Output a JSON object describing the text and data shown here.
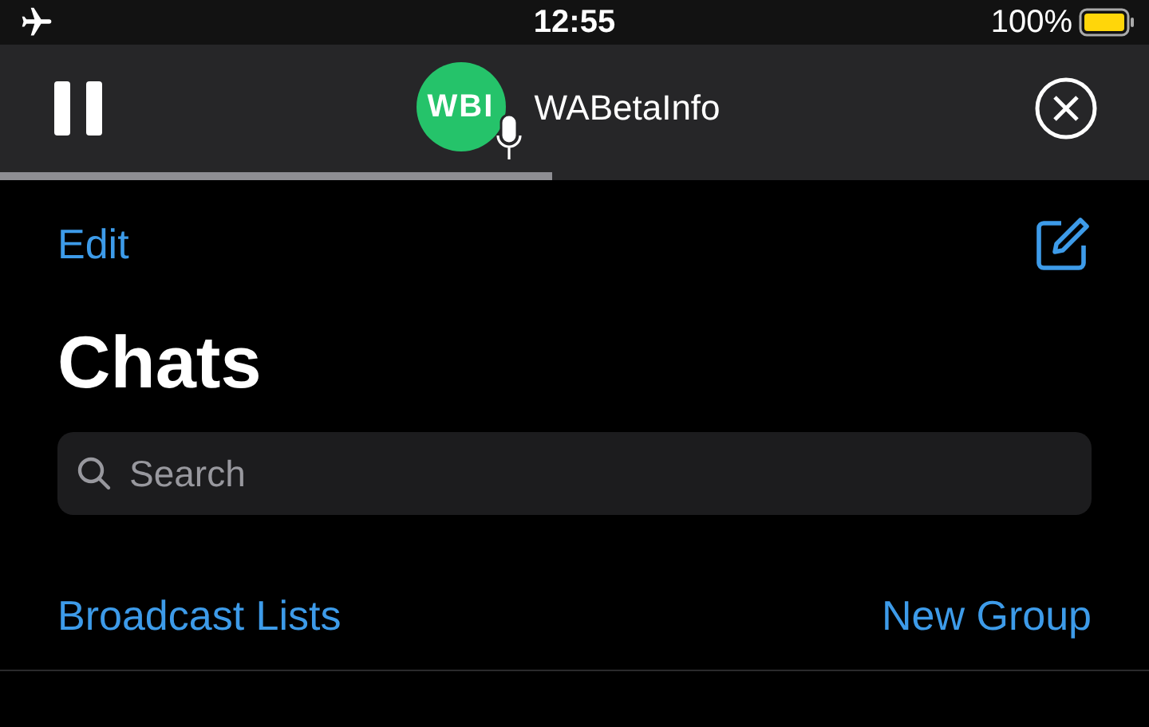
{
  "status_bar": {
    "time": "12:55",
    "battery": "100%"
  },
  "voice_player": {
    "avatar_text": "WBI",
    "title": "WABetaInfo",
    "level": 0.48
  },
  "nav": {
    "edit": "Edit"
  },
  "title": "Chats",
  "search": {
    "placeholder": "Search"
  },
  "links": {
    "left": "Broadcast Lists",
    "right": "New Group"
  }
}
